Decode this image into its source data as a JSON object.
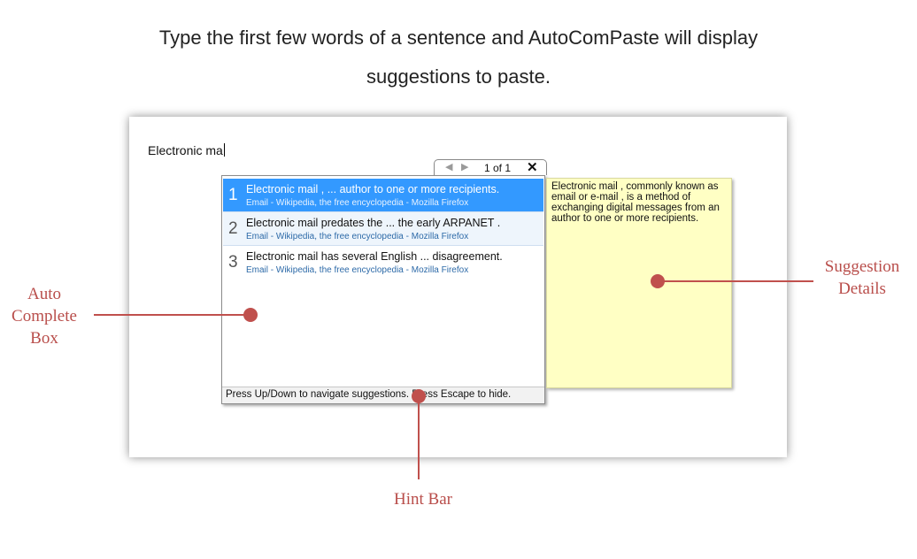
{
  "headline": {
    "line1": "Type the first few words of a sentence and AutoComPaste will display",
    "line2": "suggestions to paste."
  },
  "editor": {
    "typed_text": "Electronic ma"
  },
  "pager": {
    "prev_icon": "◀",
    "next_icon": "▶",
    "count": "1 of 1",
    "close_icon": "✕"
  },
  "suggestions": [
    {
      "num": "1",
      "title": "Electronic mail , ... author to one or more recipients.",
      "source": "Email - Wikipedia, the free encyclopedia - Mozilla Firefox"
    },
    {
      "num": "2",
      "title": "Electronic mail predates the ... the early ARPANET .",
      "source": "Email - Wikipedia, the free encyclopedia - Mozilla Firefox"
    },
    {
      "num": "3",
      "title": "Electronic mail has several English ... disagreement.",
      "source": "Email - Wikipedia, the free encyclopedia - Mozilla Firefox"
    }
  ],
  "hint_bar": "Press Up/Down to navigate suggestions. Press Escape to hide.",
  "details_text": "Electronic mail , commonly known as email or e-mail , is a method of exchanging digital messages from an author to one or more recipients.",
  "callouts": {
    "auto_complete_box": "Auto Complete Box",
    "suggestion_details": "Suggestion Details",
    "hint_bar": "Hint Bar"
  },
  "colors": {
    "selection": "#3399ff",
    "details_bg": "#ffffc4",
    "callout": "#c0504d"
  }
}
